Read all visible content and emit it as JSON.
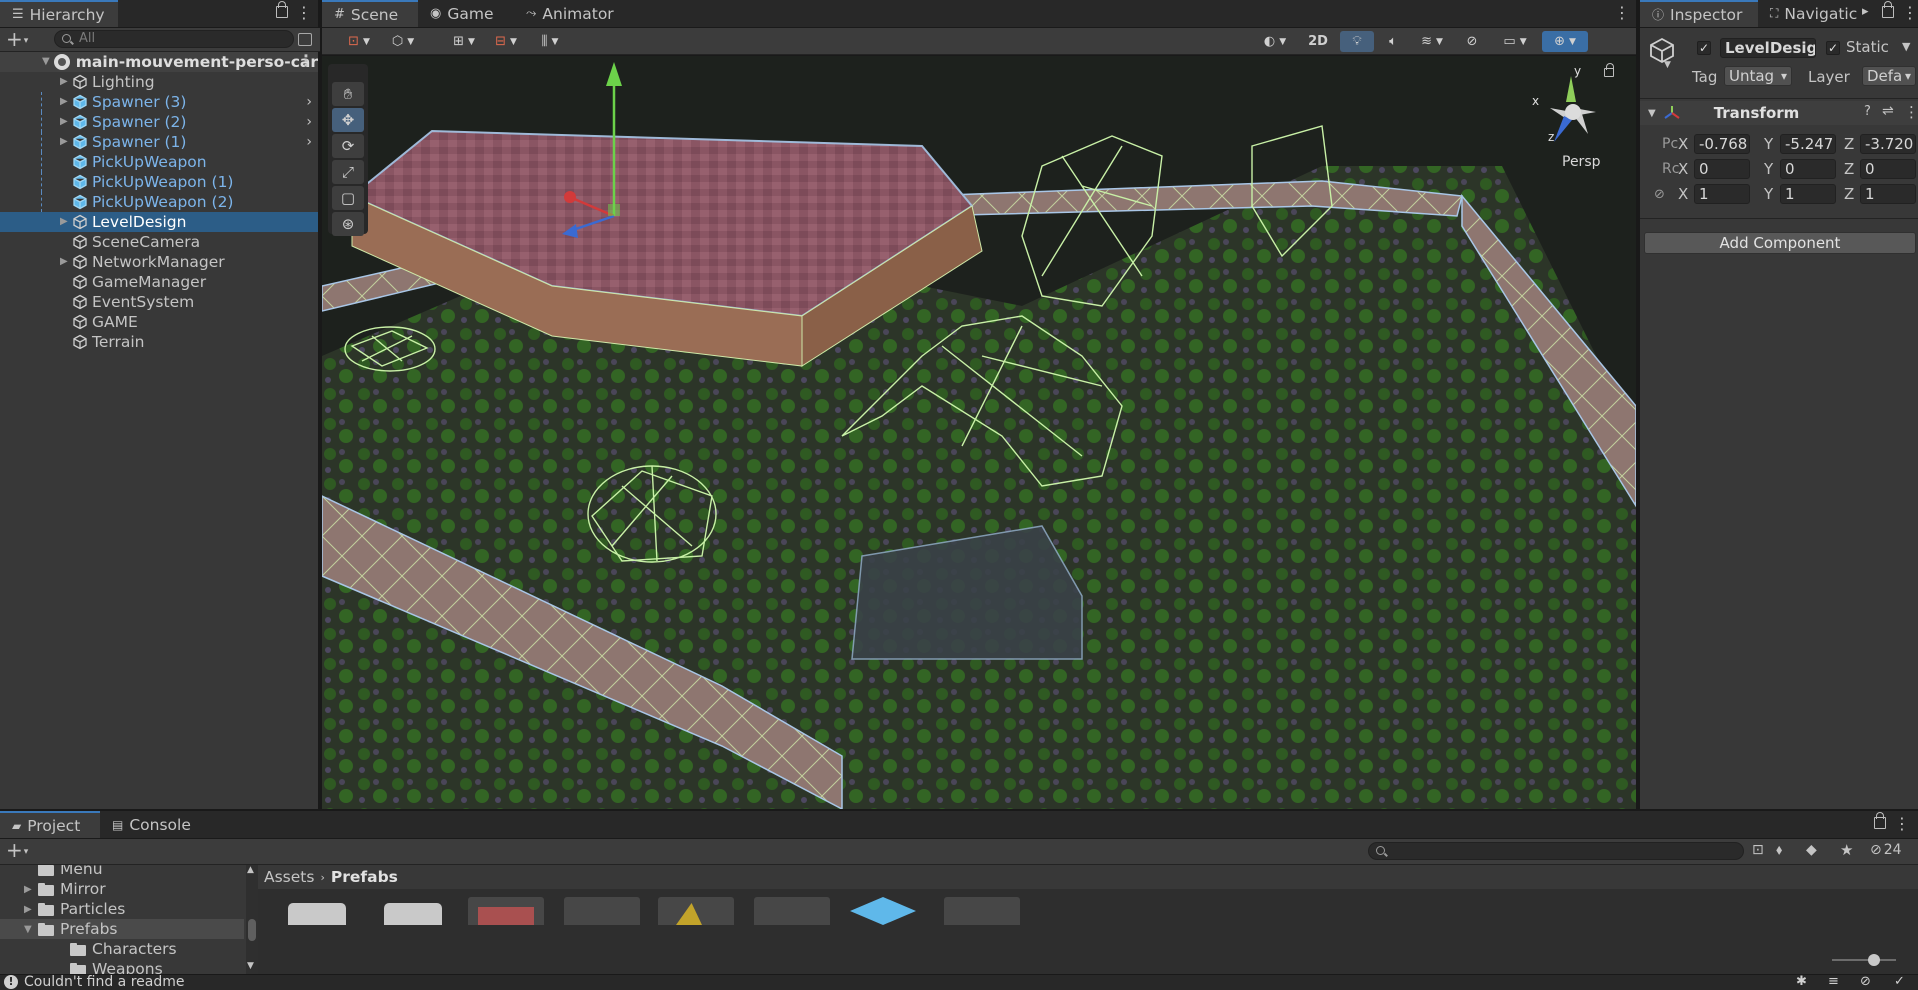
{
  "hierarchy": {
    "tab_label": "Hierarchy",
    "search_placeholder": "All",
    "scene_name": "main-mouvement-perso-car",
    "items": [
      {
        "label": "Lighting",
        "prefab": false,
        "expandable": true,
        "selected": false
      },
      {
        "label": "Spawner (3)",
        "prefab": true,
        "expandable": true,
        "selected": false
      },
      {
        "label": "Spawner (2)",
        "prefab": true,
        "expandable": true,
        "selected": false
      },
      {
        "label": "Spawner (1)",
        "prefab": true,
        "expandable": true,
        "selected": false
      },
      {
        "label": "PickUpWeapon",
        "prefab": true,
        "expandable": false,
        "selected": false
      },
      {
        "label": "PickUpWeapon (1)",
        "prefab": true,
        "expandable": false,
        "selected": false
      },
      {
        "label": "PickUpWeapon (2)",
        "prefab": true,
        "expandable": false,
        "selected": false
      },
      {
        "label": "LevelDesign",
        "prefab": false,
        "expandable": true,
        "selected": true
      },
      {
        "label": "SceneCamera",
        "prefab": false,
        "expandable": false,
        "selected": false
      },
      {
        "label": "NetworkManager",
        "prefab": false,
        "expandable": true,
        "selected": false
      },
      {
        "label": "GameManager",
        "prefab": false,
        "expandable": false,
        "selected": false
      },
      {
        "label": "EventSystem",
        "prefab": false,
        "expandable": false,
        "selected": false
      },
      {
        "label": "GAME",
        "prefab": false,
        "expandable": false,
        "selected": false
      },
      {
        "label": "Terrain",
        "prefab": false,
        "expandable": false,
        "selected": false
      }
    ]
  },
  "scene": {
    "tabs": [
      {
        "label": "Scene",
        "active": true
      },
      {
        "label": "Game",
        "active": false
      },
      {
        "label": "Animator",
        "active": false
      }
    ],
    "toolbar": {
      "mode_2d": "2D"
    },
    "gizmo": {
      "persp_label": "Persp",
      "axis_y": "y",
      "axis_x": "x",
      "axis_z": "z"
    }
  },
  "inspector": {
    "tabs": [
      {
        "label": "Inspector",
        "active": true
      },
      {
        "label": "Navigatic",
        "active": false
      }
    ],
    "object_name": "LevelDesign",
    "active_checked": true,
    "static_label": "Static",
    "static_checked": true,
    "tag_label": "Tag",
    "tag_value": "Untag",
    "layer_label": "Layer",
    "layer_value": "Defa",
    "transform_label": "Transform",
    "position": {
      "label": "Pc",
      "x": "-0.768",
      "y": "-5.247",
      "z": "-3.720"
    },
    "rotation": {
      "label": "Rc",
      "x": "0",
      "y": "0",
      "z": "0"
    },
    "scale": {
      "x": "1",
      "y": "1",
      "z": "1"
    },
    "axis": {
      "x": "X",
      "y": "Y",
      "z": "Z"
    },
    "add_component": "Add Component"
  },
  "project": {
    "tabs": [
      {
        "label": "Project",
        "active": true
      },
      {
        "label": "Console",
        "active": false
      }
    ],
    "hidden_count": "24",
    "tree": [
      {
        "label": "Menu",
        "indent": 1,
        "expanded": false,
        "selected": false,
        "arrow": false
      },
      {
        "label": "Mirror",
        "indent": 1,
        "expanded": false,
        "selected": false,
        "arrow": true
      },
      {
        "label": "Particles",
        "indent": 1,
        "expanded": false,
        "selected": false,
        "arrow": true
      },
      {
        "label": "Prefabs",
        "indent": 1,
        "expanded": true,
        "selected": true,
        "arrow": true
      },
      {
        "label": "Characters",
        "indent": 2,
        "expanded": false,
        "selected": false,
        "arrow": false
      },
      {
        "label": "Weapons",
        "indent": 2,
        "expanded": false,
        "selected": false,
        "arrow": false
      }
    ],
    "breadcrumb": [
      "Assets",
      "Prefabs"
    ]
  },
  "status": {
    "message": "Couldn't find a readme"
  }
}
